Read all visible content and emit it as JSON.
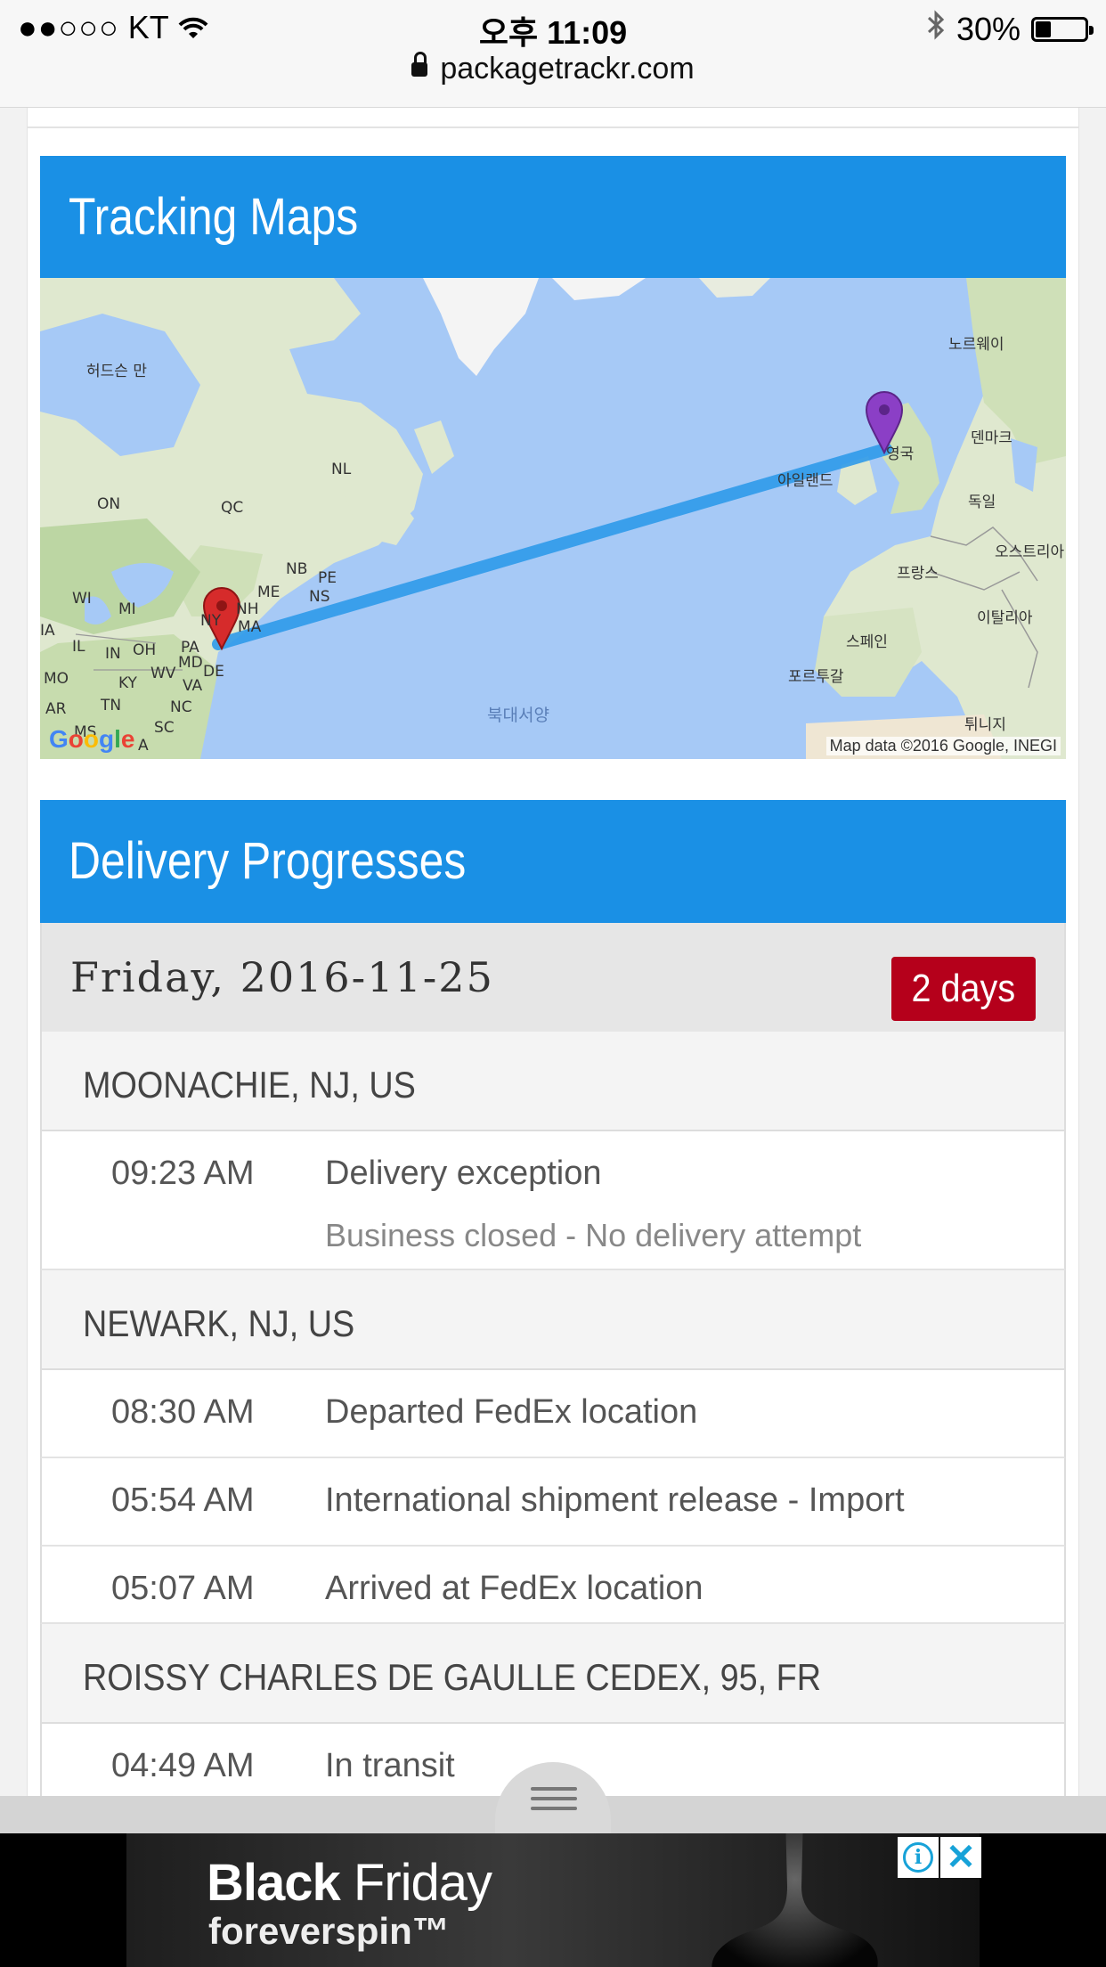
{
  "status_bar": {
    "signal_dots": "●●○○○",
    "carrier": "KT",
    "time": "오후 11:09",
    "battery_percent": "30%",
    "battery_level": 0.3
  },
  "browser": {
    "url": "packagetrackr.com"
  },
  "tracking_maps": {
    "title": "Tracking Maps",
    "map_labels": {
      "hudson_bay": "허드슨 만",
      "north_atlantic": "북대서양",
      "norway": "노르웨이",
      "denmark": "덴마크",
      "uk": "영국",
      "ireland": "아일랜드",
      "germany": "독일",
      "france": "프랑스",
      "austria": "오스트리아",
      "italy": "이탈리아",
      "spain": "스페인",
      "portugal": "포르투갈",
      "tunisia": "튀니지",
      "on": "ON",
      "qc": "QC",
      "nl": "NL",
      "nb": "NB",
      "pe": "PE",
      "ns": "NS",
      "me": "ME",
      "nh": "NH",
      "ma": "MA",
      "ny": "NY",
      "pa": "PA",
      "oh": "OH",
      "in": "IN",
      "il": "IL",
      "md": "MD",
      "de": "DE",
      "wv": "WV",
      "va": "VA",
      "ky": "KY",
      "tn": "TN",
      "nc": "NC",
      "sc": "SC",
      "ms": "MS",
      "ar": "AR",
      "mo": "MO",
      "mi": "MI",
      "wi": "WI",
      "ia": "IA",
      "al": "A"
    },
    "credit": "Map data ©2016 Google, INEGI",
    "google_logo": [
      "G",
      "o",
      "o",
      "g",
      "l",
      "e"
    ]
  },
  "delivery_progresses": {
    "title": "Delivery Progresses",
    "date": "Friday, 2016-11-25",
    "badge": "2 days",
    "groups": [
      {
        "location": "MOONACHIE, NJ, US",
        "events": [
          {
            "time": "09:23 AM",
            "desc": "Delivery exception",
            "sub": "Business closed - No delivery attempt"
          }
        ]
      },
      {
        "location": "NEWARK, NJ, US",
        "events": [
          {
            "time": "08:30 AM",
            "desc": "Departed FedEx location"
          },
          {
            "time": "05:54 AM",
            "desc": "International shipment release - Import"
          },
          {
            "time": "05:07 AM",
            "desc": "Arrived at FedEx location"
          }
        ]
      },
      {
        "location": "ROISSY CHARLES DE GAULLE CEDEX, 95, FR",
        "events": [
          {
            "time": "04:49 AM",
            "desc": "In transit"
          }
        ]
      }
    ]
  },
  "ad": {
    "title_bold": "Black",
    "title_light": "Friday",
    "subtitle": "foreverspin™",
    "info_label": "i",
    "close_label": "✕"
  },
  "colors": {
    "header_blue": "#1a90e5",
    "badge_red": "#b5001b",
    "route_blue": "#2f9bea"
  }
}
